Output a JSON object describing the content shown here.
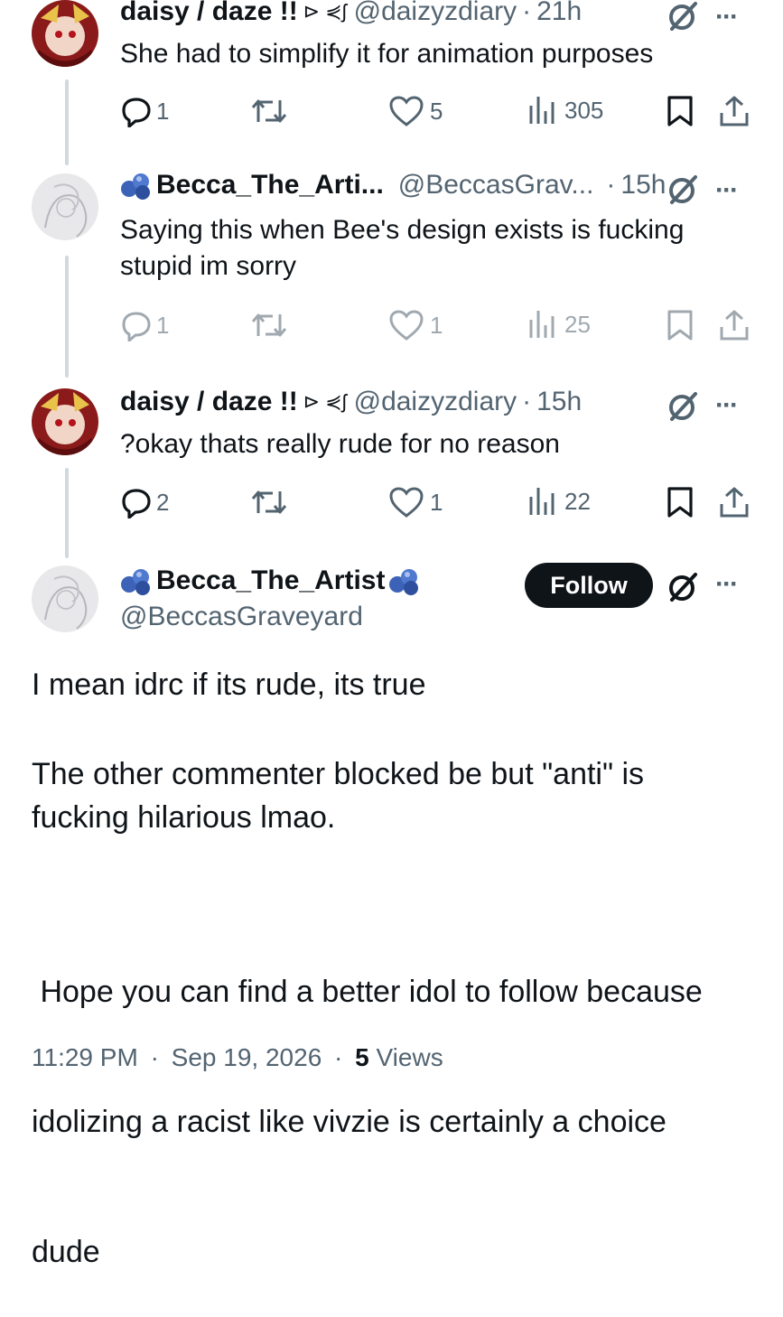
{
  "reply1": {
    "name": "daisy / daze !!",
    "name_emoji": "⊳ ⋞ʃ",
    "handle": "@daizyzdiary",
    "time": "21h",
    "text": "She had to simplify it for animation purposes",
    "stats": {
      "replies": "1",
      "reposts": "",
      "likes": "5",
      "views": "305"
    }
  },
  "reply2": {
    "name": "Becca_The_Arti...",
    "handle": "@BeccasGrav...",
    "time": "15h",
    "text_line1": "Saying this when Bee's design exists is fucking",
    "text_line2": "stupid im sorry",
    "stats": {
      "replies": "1",
      "reposts": "",
      "likes": "1",
      "views": "25"
    }
  },
  "reply3": {
    "name": "daisy / daze !!",
    "name_emoji": "⊳ ⋞ʃ",
    "handle": "@daizyzdiary",
    "time": "15h",
    "text": "?okay thats really rude for no reason",
    "stats": {
      "replies": "2",
      "reposts": "",
      "likes": "1",
      "views": "22"
    }
  },
  "main_post": {
    "name": "Becca_The_Artist",
    "handle": "@BeccasGraveyard",
    "follow_label": "Follow",
    "paragraph1": "I mean idrc if its rude, its true",
    "paragraph2_line1": "The other commenter blocked be but \"anti\" is",
    "paragraph2_line2": "fucking hilarious lmao.",
    "paragraph3_line1": " Hope you can find a better idol to follow because",
    "paragraph3_line2": "idolizing a racist like vivzie is certainly a choice",
    "paragraph3_line3": "dude",
    "timestamp": "11:29 PM",
    "date": "Sep 19, 2026",
    "views_count": "5",
    "views_label": "Views"
  },
  "dot_separator": "·",
  "more_label": "···",
  "icons": [
    "reply-icon",
    "repost-icon",
    "like-icon",
    "views-icon",
    "bookmark-icon",
    "share-icon",
    "grok-icon",
    "more-icon",
    "blue-blob-emoji-icon"
  ]
}
